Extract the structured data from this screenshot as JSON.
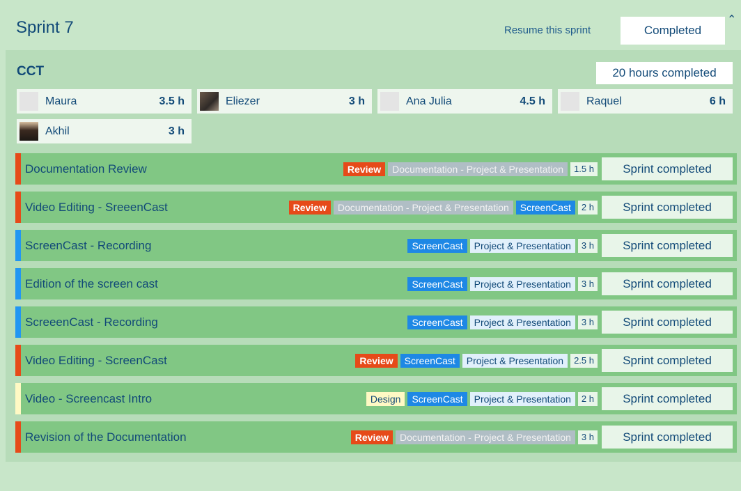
{
  "header": {
    "sprint_title": "Sprint 7",
    "resume_label": "Resume this sprint",
    "completed_label": "Completed",
    "collapse_icon": "chevron-up-icon"
  },
  "team": {
    "name": "CCT",
    "hours_completed": "20 hours completed",
    "members": [
      {
        "name": "Maura",
        "hours": "3.5 h",
        "avatar": "placeholder"
      },
      {
        "name": "Eliezer",
        "hours": "3 h",
        "avatar": "photo"
      },
      {
        "name": "Ana Julia",
        "hours": "4.5 h",
        "avatar": "placeholder"
      },
      {
        "name": "Raquel",
        "hours": "6 h",
        "avatar": "placeholder"
      },
      {
        "name": "Akhil",
        "hours": "3 h",
        "avatar": "photo"
      }
    ]
  },
  "tasks": [
    {
      "title": "Documentation Review",
      "tags": [
        "Review",
        "Documentation - Project & Presentation"
      ],
      "hours": "1.5 h",
      "status": "Sprint completed"
    },
    {
      "title": "Video Editing - SreeenCast",
      "tags": [
        "Review",
        "Documentation - Project & Presentation",
        "ScreenCast"
      ],
      "hours": "2 h",
      "status": "Sprint completed"
    },
    {
      "title": "ScreenCast - Recording",
      "tags": [
        "ScreenCast",
        "Project & Presentation"
      ],
      "hours": "3 h",
      "status": "Sprint completed"
    },
    {
      "title": "Edition of the screen cast",
      "tags": [
        "ScreenCast",
        "Project & Presentation"
      ],
      "hours": "3 h",
      "status": "Sprint completed"
    },
    {
      "title": "ScreeenCast - Recording",
      "tags": [
        "ScreenCast",
        "Project & Presentation"
      ],
      "hours": "3 h",
      "status": "Sprint completed"
    },
    {
      "title": "Video Editing - ScreenCast",
      "tags": [
        "Review",
        "ScreenCast",
        "Project & Presentation"
      ],
      "hours": "2.5 h",
      "status": "Sprint completed"
    },
    {
      "title": "Video - Screencast Intro",
      "tags": [
        "Design",
        "ScreenCast",
        "Project & Presentation"
      ],
      "hours": "2 h",
      "status": "Sprint completed"
    },
    {
      "title": "Revision of the Documentation",
      "tags": [
        "Review",
        "Documentation - Project & Presentation"
      ],
      "hours": "3 h",
      "status": "Sprint completed"
    }
  ],
  "colors": {
    "review": "#e64a19",
    "screencast": "#1e88e5",
    "design": "#fff9c4",
    "task_bg": "#81c784"
  }
}
